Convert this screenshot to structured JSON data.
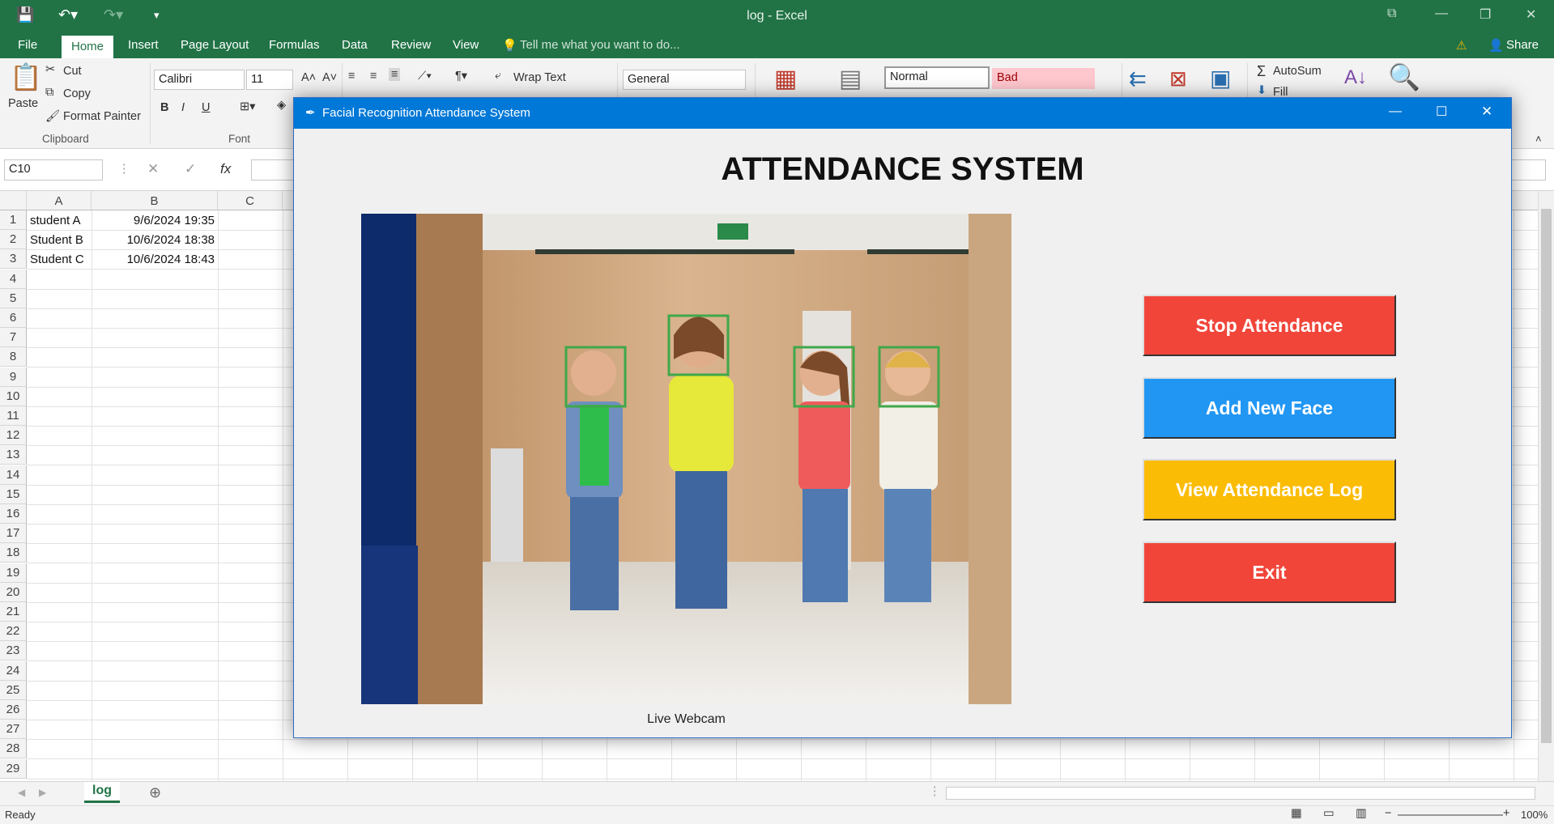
{
  "excel": {
    "window_title": "log - Excel",
    "tabs": [
      "File",
      "Home",
      "Insert",
      "Page Layout",
      "Formulas",
      "Data",
      "Review",
      "View"
    ],
    "tell_me": "Tell me what you want to do...",
    "share": "Share",
    "clipboard": {
      "paste": "Paste",
      "cut": "Cut",
      "copy": "Copy",
      "format_painter": "Format Painter",
      "group": "Clipboard"
    },
    "font": {
      "name": "Calibri",
      "size": "11",
      "group": "Font",
      "bold": "B",
      "italic": "I",
      "underline": "U"
    },
    "alignment": {
      "wrap_text": "Wrap Text"
    },
    "number": {
      "format": "General"
    },
    "styles": {
      "normal": "Normal",
      "bad": "Bad"
    },
    "editing": {
      "autosum": "AutoSum",
      "fill": "Fill"
    },
    "name_box": "C10",
    "columns": [
      "A",
      "B",
      "C"
    ],
    "rows": [
      "1",
      "2",
      "3",
      "4",
      "5",
      "6",
      "7",
      "8",
      "9",
      "10",
      "11",
      "12",
      "13",
      "14",
      "15",
      "16",
      "17",
      "18",
      "19",
      "20",
      "21",
      "22",
      "23",
      "24",
      "25",
      "26",
      "27",
      "28",
      "29"
    ],
    "cells": [
      {
        "a": "student A",
        "b": "9/6/2024 19:35"
      },
      {
        "a": "Student B",
        "b": "10/6/2024 18:38"
      },
      {
        "a": "Student C",
        "b": "10/6/2024 18:43"
      }
    ],
    "sheet_tab": "log",
    "status": "Ready",
    "zoom": "100%"
  },
  "app": {
    "title": "Facial Recognition Attendance System",
    "heading": "ATTENDANCE SYSTEM",
    "webcam_caption": "Live Webcam",
    "buttons": [
      {
        "label": "Stop Attendance",
        "color": "#f1453a"
      },
      {
        "label": "Add New Face",
        "color": "#2196f3"
      },
      {
        "label": "View Attendance Log",
        "color": "#fbbc05"
      },
      {
        "label": "Exit",
        "color": "#f1453a"
      }
    ],
    "detected_faces": 4
  }
}
